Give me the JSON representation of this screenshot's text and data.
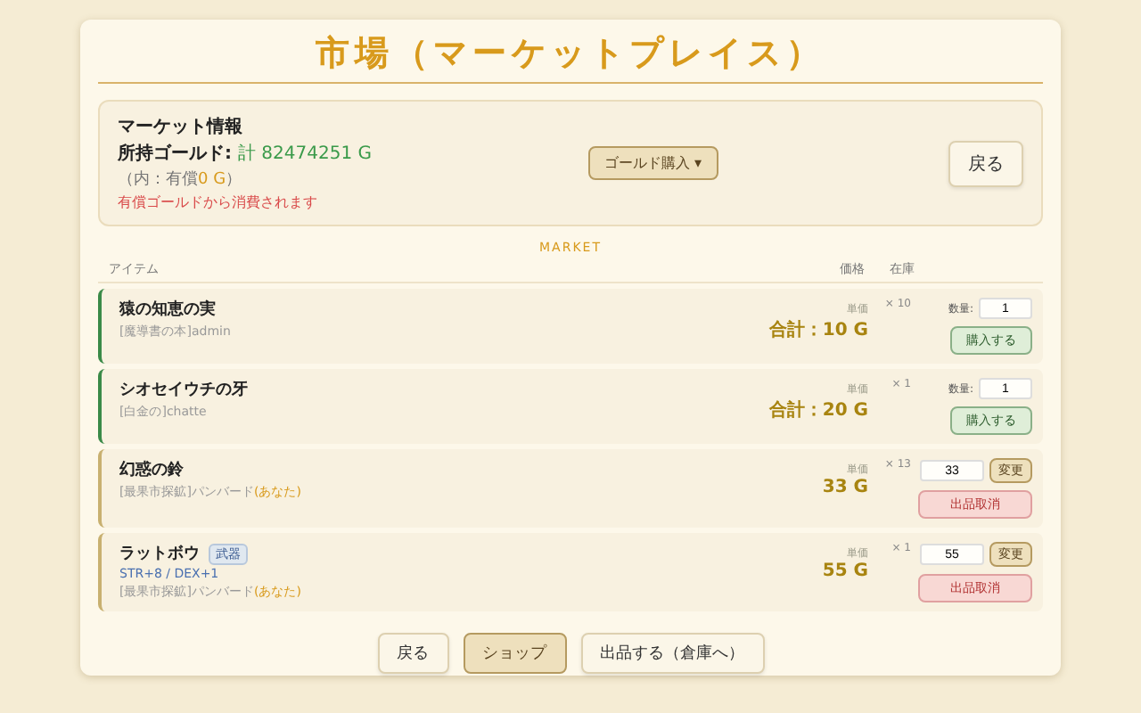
{
  "title": "市場（マーケットプレイス）",
  "info": {
    "heading": "マーケット情報",
    "gold_label": "所持ゴールド:",
    "gold_value": "計 82474251 G",
    "paid_note": "（内：有償",
    "paid_value": "0 G",
    "paid_close": "）",
    "warning": "有償ゴールドから消費されます",
    "buy_gold": "ゴールド購入 ▾",
    "back": "戻る"
  },
  "section": "MARKET",
  "columns": [
    "アイテム",
    "価格",
    "在庫"
  ],
  "items": [
    {
      "kind": "buy",
      "name": "猿の知恵の実",
      "seller": "[魔導書の本]admin",
      "unit": "単価",
      "price": "合計：10 G",
      "stock": "× 10",
      "qty_label": "数量:",
      "qty": "1",
      "action": "購入する"
    },
    {
      "kind": "buy",
      "name": "シオセイウチの牙",
      "seller": "[白金の]chatte",
      "unit": "単価",
      "price": "合計：20 G",
      "stock": "× 1",
      "qty_label": "数量:",
      "qty": "1",
      "action": "購入する"
    },
    {
      "kind": "own",
      "name": "幻惑の鈴",
      "seller": "[最果市探鉱]パンバード",
      "you": "(あなた)",
      "unit": "単価",
      "price": "33 G",
      "stock": "× 13",
      "qty": "33",
      "action": "変更",
      "cancel": "出品取消"
    },
    {
      "kind": "own",
      "name": "ラットボウ",
      "tag": "武器",
      "stats": "STR+8 / DEX+1",
      "seller": "[最果市探鉱]パンバード",
      "you": "(あなた)",
      "unit": "単価",
      "price": "55 G",
      "stock": "× 1",
      "qty": "55",
      "action": "変更",
      "cancel": "出品取消"
    }
  ],
  "footer": [
    {
      "label": "戻る",
      "selected": false
    },
    {
      "label": "ショップ",
      "selected": true
    },
    {
      "label": "出品する（倉庫へ）",
      "selected": false
    }
  ]
}
